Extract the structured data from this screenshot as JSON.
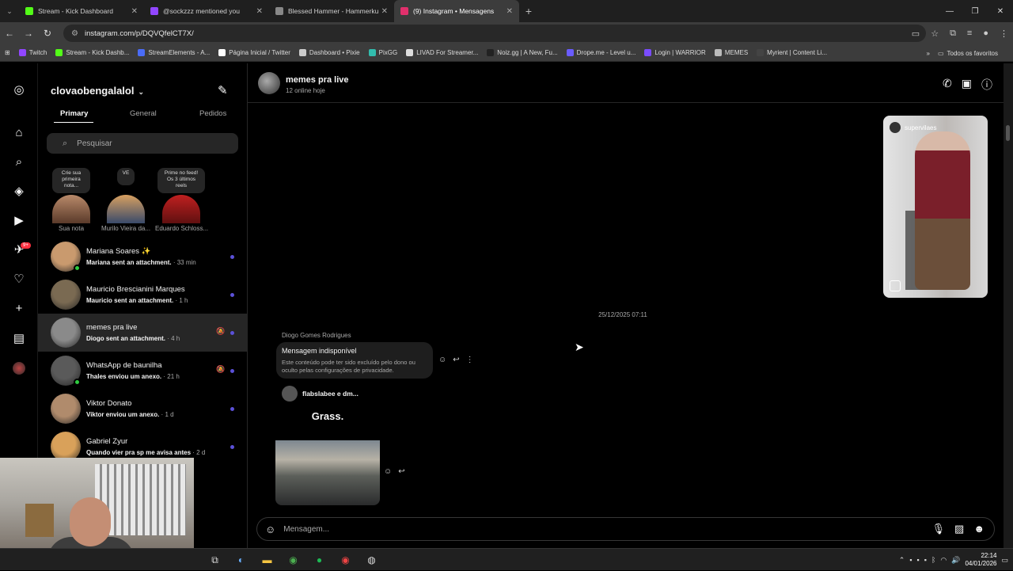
{
  "browser": {
    "tabs": [
      {
        "title": "Stream - Kick Dashboard",
        "color": "#53fc18",
        "active": false
      },
      {
        "title": "@sockzzz mentioned you",
        "color": "#9146ff",
        "active": false
      },
      {
        "title": "Blessed Hammer - Hammerkur",
        "color": "#888888",
        "active": false
      },
      {
        "title": "(9) Instagram • Mensagens",
        "color": "#e1306c",
        "active": true
      }
    ],
    "url": "instagram.com/p/DQVQfelCT7X/",
    "bookmarks": [
      {
        "label": "Twitch",
        "color": "#9146ff"
      },
      {
        "label": "Stream - Kick Dashb...",
        "color": "#53fc18"
      },
      {
        "label": "StreamElements - A...",
        "color": "#4a6cf7"
      },
      {
        "label": "Página Inicial / Twitter",
        "color": "#ffffff"
      },
      {
        "label": "Dashboard • Pixie",
        "color": "#cccccc"
      },
      {
        "label": "PixGG",
        "color": "#32bcad"
      },
      {
        "label": "LIVAD For Streamer...",
        "color": "#dddddd"
      },
      {
        "label": "Noiz.gg | A New, Fu...",
        "color": "#222222"
      },
      {
        "label": "Drope.me - Level u...",
        "color": "#6a5cff"
      },
      {
        "label": "Login | WARRIOR",
        "color": "#7a4cff"
      },
      {
        "label": "MEMES",
        "color": "#bbbbbb"
      },
      {
        "label": "Myrient | Content Li...",
        "color": "#444444"
      }
    ],
    "all_bookmarks": "Todos os favoritos"
  },
  "sidebar": {
    "account": "clovaobengalalol",
    "tabs": [
      "Primary",
      "General",
      "Pedidos"
    ],
    "search_placeholder": "Pesquisar",
    "notes": [
      {
        "bubble": "Crie sua primeira nota...",
        "name": "Sua nota"
      },
      {
        "bubble": "VE",
        "name": "Murilo Vieira da..."
      },
      {
        "bubble": "Prime no feed! Os 3 últimos reels",
        "name": "Eduardo Schloss..."
      }
    ],
    "conversations": [
      {
        "name": "Mariana Soares ✨",
        "msg": "Mariana sent an attachment.",
        "time": " · 33 min",
        "online": true,
        "muted": false,
        "color": "#c99a6e"
      },
      {
        "name": "Mauricio Brescianini Marques",
        "msg": "Mauricio sent an attachment.",
        "time": " · 1 h",
        "online": false,
        "muted": false,
        "color": "#7a6a52"
      },
      {
        "name": "memes pra live",
        "msg": "Diogo sent an attachment.",
        "time": " · 4 h",
        "online": false,
        "muted": true,
        "color": "#8a8a8a"
      },
      {
        "name": "WhatsApp de baunilha",
        "msg": "Thales enviou um anexo.",
        "time": " · 21 h",
        "online": true,
        "muted": true,
        "color": "#5a5a5a"
      },
      {
        "name": "Viktor Donato",
        "msg": "Viktor enviou um anexo.",
        "time": " · 1 d",
        "online": false,
        "muted": false,
        "color": "#b08b6c"
      },
      {
        "name": "Gabriel Zyur",
        "msg": "Quando vier pra sp me avisa antes",
        "time": " · 2 d",
        "online": false,
        "muted": false,
        "color": "#d9a15a"
      }
    ],
    "notification_badge": "9+"
  },
  "chat": {
    "title": "memes pra live",
    "subtitle": "12 online hoje",
    "reel_source": "supervilaes",
    "date": "25/12/2025 07:11",
    "sender": "Diogo Gomes Rodrigues",
    "unavailable_title": "Mensagem indisponível",
    "unavailable_body": "Este conteúdo pode ter sido excluído pelo dono ou oculto pelas configurações de privacidade.",
    "post_author": "flabslabee e dm...",
    "post_text": "Grass.",
    "composer_placeholder": "Mensagem..."
  },
  "taskbar": {
    "time": "22:14",
    "date": "04/01/2026"
  }
}
